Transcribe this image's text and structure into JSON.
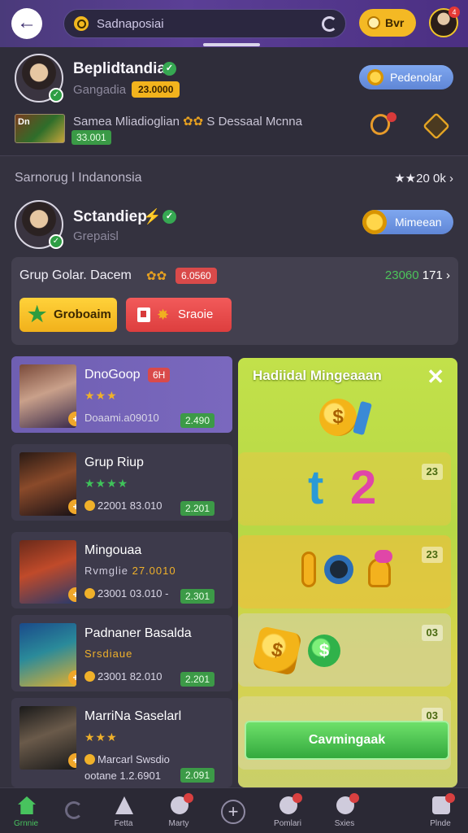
{
  "topbar": {
    "search_value": "Sadnaposiai",
    "buy_label": "Bvr",
    "avatar_badge": "4"
  },
  "profile": {
    "name": "Beplidtandia",
    "subtitle": "Gangadia",
    "amount_pill": "23.0000",
    "action_button": "Pedenolar",
    "game_thumb_label": "Dn",
    "stat_text": "Samea Mliadioglian",
    "stat_text_2": "S Dessaal Mcnna",
    "green_value": "33.001"
  },
  "section": {
    "title": "Sarnorug l Indanonsia",
    "right": "★★20 0k"
  },
  "profile2": {
    "name": "Sctandiep",
    "subtitle": "Grepaisl",
    "action_button": "Mimeean"
  },
  "group": {
    "title": "Grup Golar. Dacem",
    "red_pill": "6.0560",
    "count_green": "23060",
    "count_white": "171",
    "btn_yellow": "Groboaim",
    "btn_red": "Sraoie"
  },
  "list": [
    {
      "title": "DnoGoop",
      "tag": "6H",
      "stars": "★★★",
      "meta": "Doaami.a09010",
      "value": "2.490",
      "star_color": "#f0b12a"
    },
    {
      "title": "Grup Riup",
      "tag": "",
      "stars": "★★★★",
      "meta": "22001 83.010",
      "value": "2.201",
      "star_color": "#3fc35a"
    },
    {
      "title": "Mingouaa",
      "tag": "",
      "stars": "Rvmglie",
      "meta": "23001 03.010 -",
      "value": "2.301",
      "star_color": "#cfcbdc",
      "extra": "27.0010"
    },
    {
      "title": "Padnaner Basalda",
      "tag": "",
      "stars": "Srsdiaue",
      "meta": "23001 82.010",
      "value": "2.201",
      "star_color": "#f0b12a"
    },
    {
      "title": "MarriNa Saselarl",
      "tag": "",
      "stars": "★★★",
      "meta": "Marcarl Swsdio",
      "value": "2.091",
      "star_color": "#f0b12a",
      "extra": "ootane 1.2.6901"
    }
  ],
  "reward": {
    "title": "Hadiidal Mingeaaan",
    "row_nums": [
      "23",
      "23",
      "03",
      "03"
    ],
    "cta": "Cavmingaak"
  },
  "nav": {
    "items": [
      "Grnnie",
      "Fetta",
      "Marty",
      "Pomlari",
      "Sxies",
      "Plnde"
    ]
  }
}
